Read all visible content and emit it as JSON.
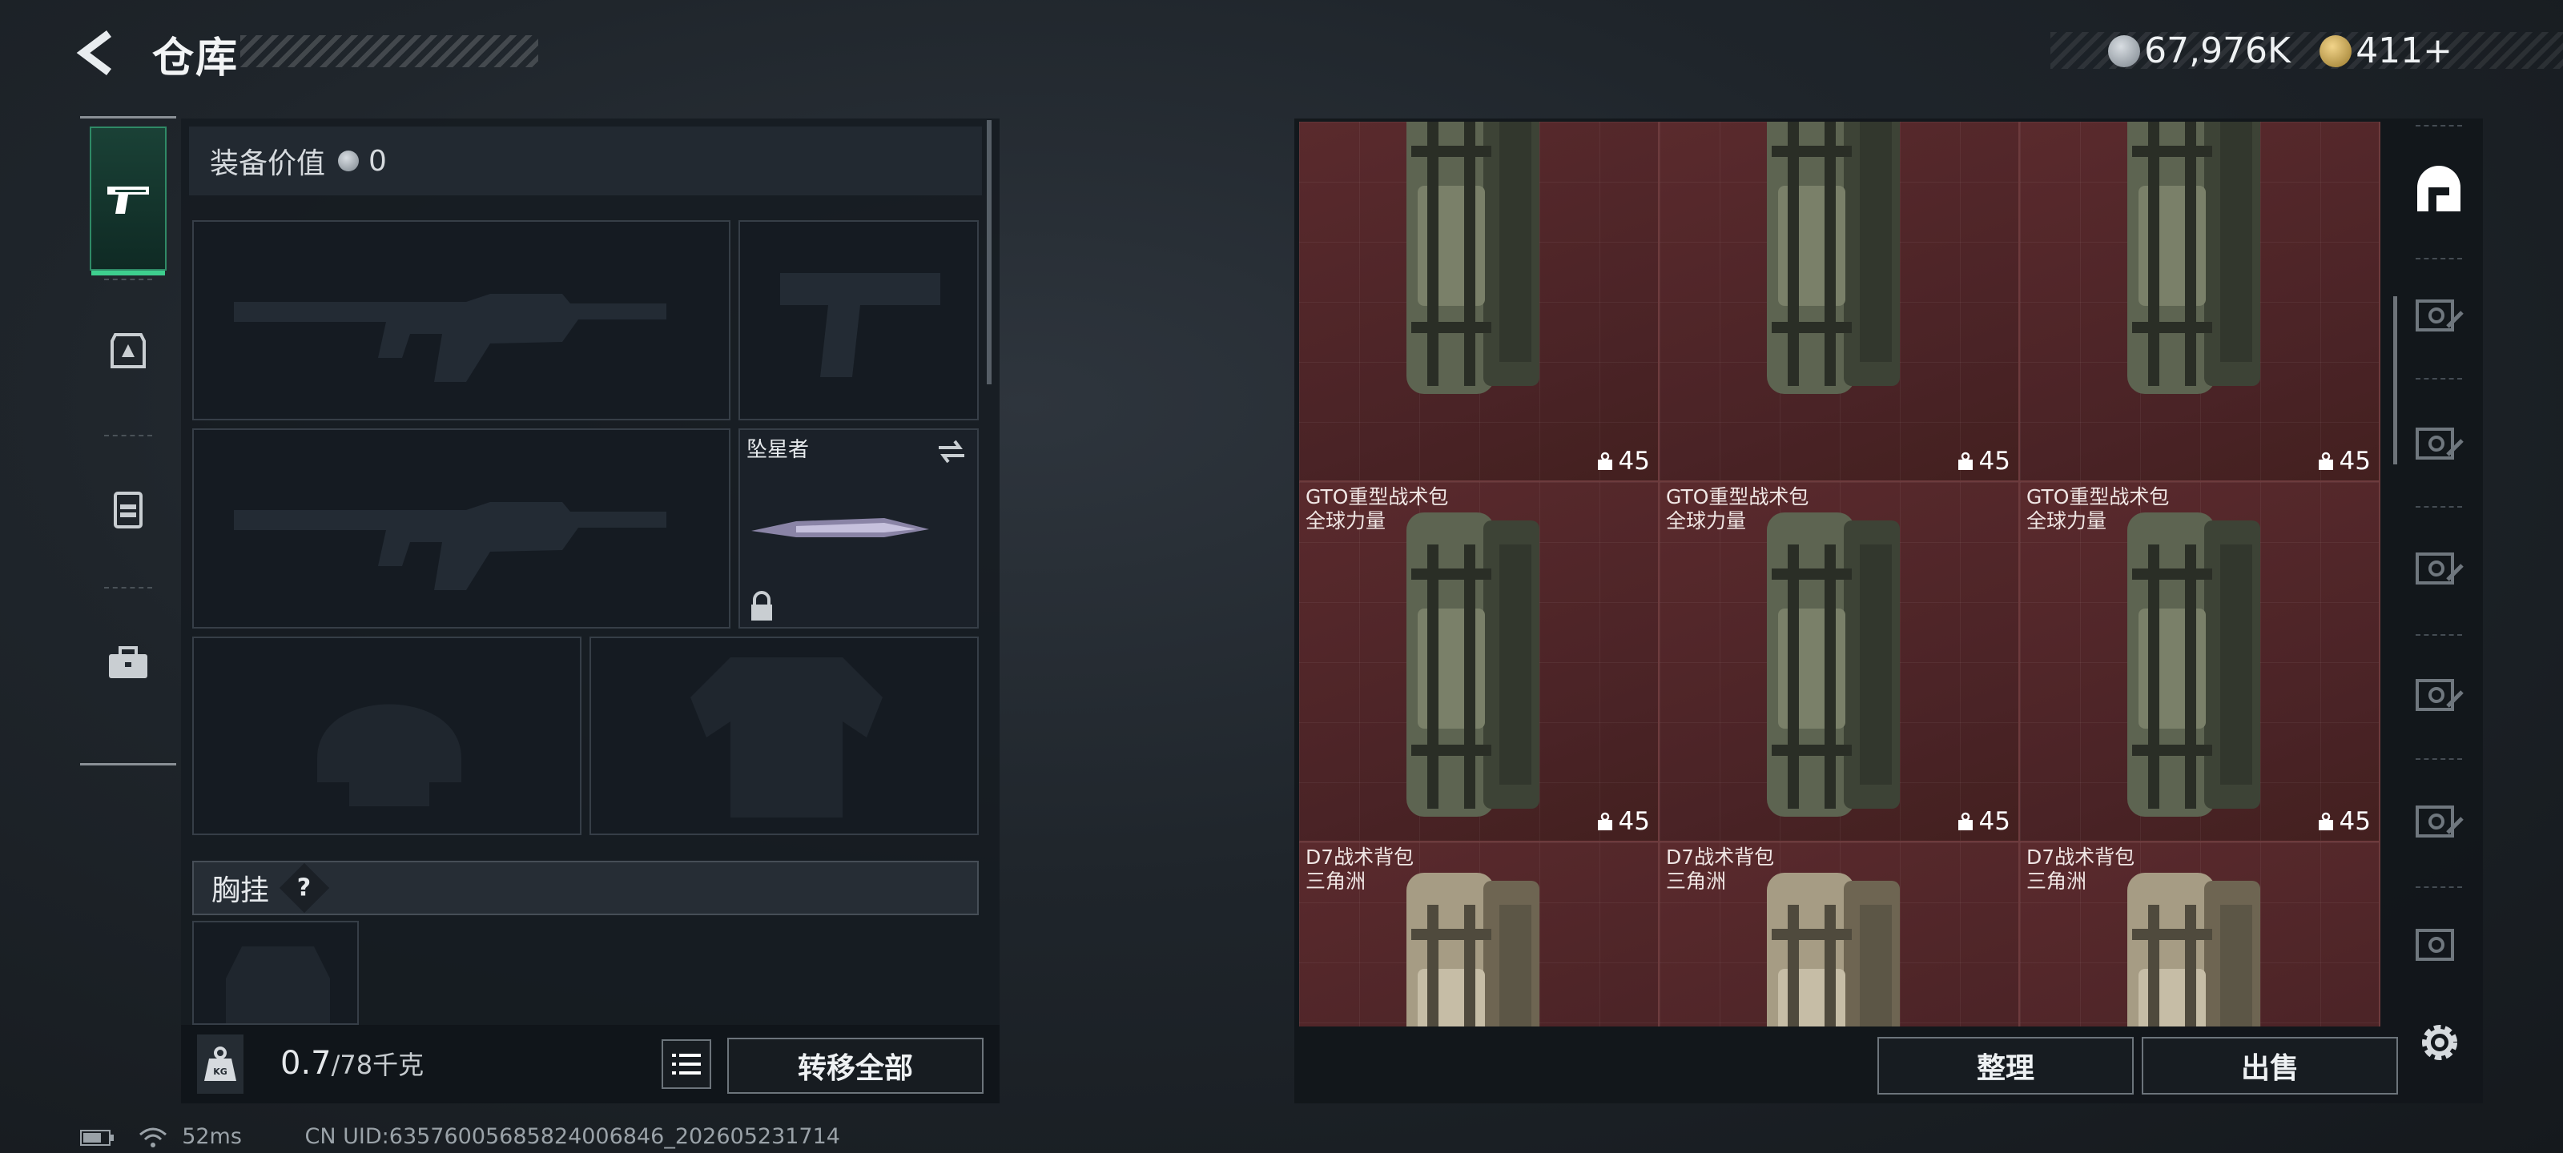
{
  "header": {
    "title": "仓库",
    "currency": {
      "silver_amount": "67,976K",
      "gold_amount": "411+"
    }
  },
  "left_nav": {
    "items": [
      "pistol-icon",
      "armor-icon",
      "backpack-icon",
      "toolbox-icon"
    ],
    "active": 0
  },
  "loadout": {
    "equipment_value_label": "装备价值",
    "equipment_value": "0",
    "melee_name": "坠星者",
    "chest_rig_label": "胸挂",
    "chest_rig_help": "?"
  },
  "capacity": {
    "used": "0.7",
    "total": "/78千克"
  },
  "buttons": {
    "transfer_all": "转移全部",
    "organize": "整理",
    "sell": "出售"
  },
  "storage_items": [
    {
      "name": "",
      "name2": "",
      "capacity": "45",
      "color": "olive"
    },
    {
      "name": "",
      "name2": "",
      "capacity": "45",
      "color": "olive"
    },
    {
      "name": "",
      "name2": "",
      "capacity": "45",
      "color": "olive"
    },
    {
      "name": "GTO重型战术包",
      "name2": "全球力量",
      "capacity": "45",
      "color": "olive"
    },
    {
      "name": "GTO重型战术包",
      "name2": "全球力量",
      "capacity": "45",
      "color": "olive"
    },
    {
      "name": "GTO重型战术包",
      "name2": "全球力量",
      "capacity": "45",
      "color": "olive"
    },
    {
      "name": "D7战术背包",
      "name2": "三角洲",
      "capacity": "",
      "color": "tan"
    },
    {
      "name": "D7战术背包",
      "name2": "三角洲",
      "capacity": "",
      "color": "tan"
    },
    {
      "name": "D7战术背包",
      "name2": "三角洲",
      "capacity": "",
      "color": "tan"
    }
  ],
  "footer": {
    "ping": "52ms",
    "uid": "CN UID:63576005685824006846_202605231714"
  },
  "colors": {
    "accent": "#3ecf8e",
    "cell_bg": "#4a2326",
    "panel_bg": "#161b21"
  }
}
